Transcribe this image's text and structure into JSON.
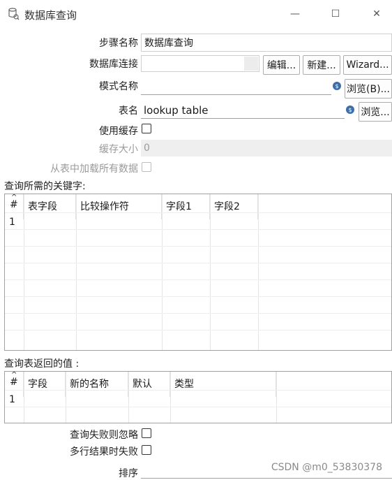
{
  "window": {
    "title": "数据库查询",
    "minimize": "—",
    "maximize": "☐",
    "close": "✕"
  },
  "form": {
    "step_name_label": "步骤名称",
    "step_name_value": "数据库查询",
    "connection_label": "数据库连接",
    "connection_value": "",
    "edit_button": "编辑...",
    "new_button": "新建...",
    "wizard_button": "Wizard...",
    "schema_label": "模式名称",
    "schema_value": "",
    "browse_b_button": "浏览(B)...",
    "table_label": "表名",
    "table_value": "lookup table",
    "browse_button": "浏览...",
    "use_cache_label": "使用缓存",
    "use_cache_checked": false,
    "cache_size_label": "缓存大小",
    "cache_size_value": "0",
    "load_all_label": "从表中加载所有数据",
    "load_all_checked": false
  },
  "keys_section": {
    "label": "查询所需的关键字:",
    "columns": [
      "#",
      "表字段",
      "比较操作符",
      "字段1",
      "字段2"
    ],
    "rows": [
      [
        "1",
        "",
        "",
        "",
        ""
      ]
    ]
  },
  "return_section": {
    "label": "查询表返回的值 :",
    "columns": [
      "#",
      "字段",
      "新的名称",
      "默认",
      "类型"
    ],
    "rows": [
      [
        "1",
        "",
        "",
        "",
        ""
      ]
    ]
  },
  "options": {
    "fail_ignore_label": "查询失败则忽略",
    "fail_ignore_checked": false,
    "multi_fail_label": "多行结果时失败",
    "multi_fail_checked": false,
    "order_label": "排序",
    "order_value": ""
  },
  "watermark": "CSDN @m0_53830378",
  "colors": {
    "variable_icon": "#3d6ea8",
    "disabled_text": "#9a9a9a"
  }
}
